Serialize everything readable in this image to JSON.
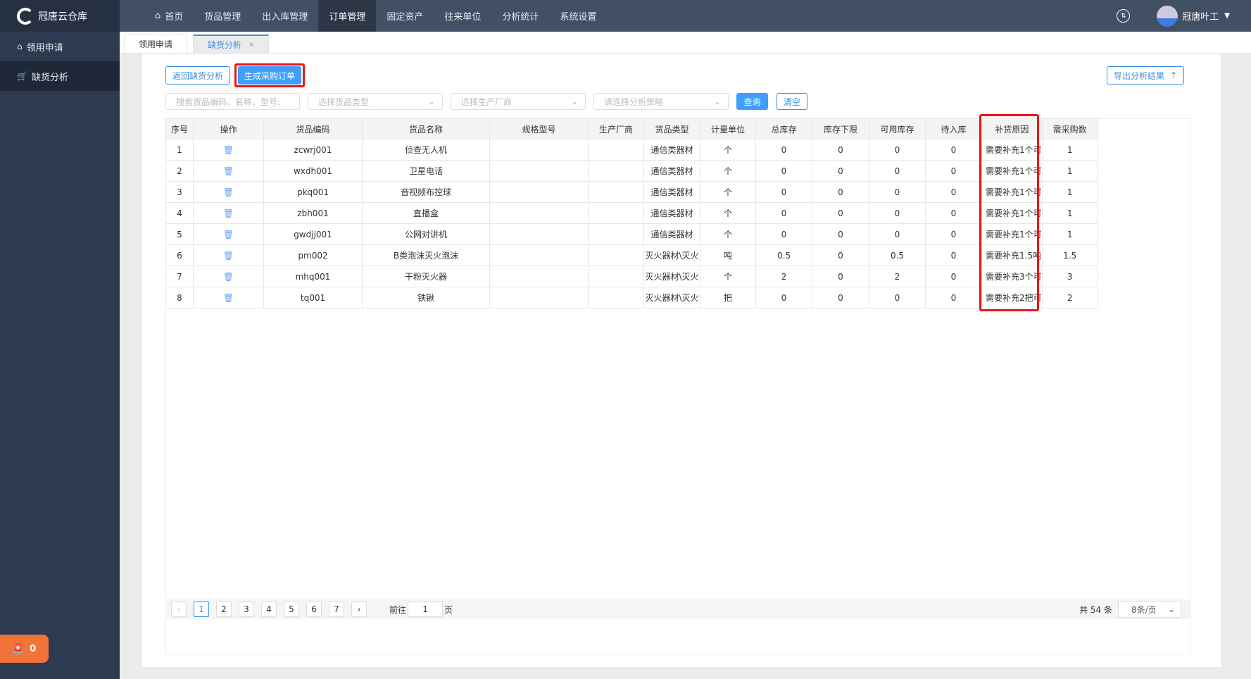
{
  "app": {
    "title": "冠唐云仓库"
  },
  "sidebar": {
    "items": [
      {
        "label": "领用申请",
        "icon": "box-icon"
      },
      {
        "label": "缺货分析",
        "icon": "cart-icon"
      }
    ]
  },
  "topnav": {
    "items": [
      "首页",
      "货品管理",
      "出入库管理",
      "订单管理",
      "固定资产",
      "往来单位",
      "分析统计",
      "系统设置"
    ],
    "active": "订单管理",
    "user": "冠唐叶工"
  },
  "tabs": [
    {
      "label": "领用申请"
    },
    {
      "label": "缺货分析",
      "close": "×"
    }
  ],
  "toolbar": {
    "back": "返回缺货分析",
    "generate": "生成采购订单",
    "export": "导出分析结果",
    "export_icon": "⇡"
  },
  "filters": {
    "search_placeholder": "搜索货品编码、名称、型号:",
    "type_placeholder": "选择货品类型",
    "maker_placeholder": "选择生产厂商",
    "strategy_placeholder": "请选择分析策略",
    "query": "查询",
    "clear": "清空"
  },
  "table": {
    "headers": [
      "序号",
      "操作",
      "货品编码",
      "货品名称",
      "规格型号",
      "生产厂商",
      "货品类型",
      "计量单位",
      "总库存",
      "库存下限",
      "可用库存",
      "待入库",
      "补货原因",
      "需采购数"
    ],
    "rows": [
      [
        "1",
        "",
        "zcwrj001",
        "侦查无人机",
        "",
        "",
        "通信类器材",
        "个",
        "0",
        "0",
        "0",
        "0",
        "需要补充1个可",
        "1"
      ],
      [
        "2",
        "",
        "wxdh001",
        "卫星电话",
        "",
        "",
        "通信类器材",
        "个",
        "0",
        "0",
        "0",
        "0",
        "需要补充1个可",
        "1"
      ],
      [
        "3",
        "",
        "pkq001",
        "音视频布控球",
        "",
        "",
        "通信类器材",
        "个",
        "0",
        "0",
        "0",
        "0",
        "需要补充1个可",
        "1"
      ],
      [
        "4",
        "",
        "zbh001",
        "直播盒",
        "",
        "",
        "通信类器材",
        "个",
        "0",
        "0",
        "0",
        "0",
        "需要补充1个可",
        "1"
      ],
      [
        "5",
        "",
        "gwdjj001",
        "公网对讲机",
        "",
        "",
        "通信类器材",
        "个",
        "0",
        "0",
        "0",
        "0",
        "需要补充1个可",
        "1"
      ],
      [
        "6",
        "",
        "pm002",
        "B类泡沫灭火泡沫",
        "",
        "",
        "灭火器材\\灭火",
        "吨",
        "0.5",
        "0",
        "0.5",
        "0",
        "需要补充1.5吨",
        "1.5"
      ],
      [
        "7",
        "",
        "mhq001",
        "干粉灭火器",
        "",
        "",
        "灭火器材\\灭火",
        "个",
        "2",
        "0",
        "2",
        "0",
        "需要补充3个可",
        "3"
      ],
      [
        "8",
        "",
        "tq001",
        "铁锹",
        "",
        "",
        "灭火器材\\灭火",
        "把",
        "0",
        "0",
        "0",
        "0",
        "需要补充2把可",
        "2"
      ]
    ]
  },
  "pager": {
    "pages": [
      "1",
      "2",
      "3",
      "4",
      "5",
      "6",
      "7"
    ],
    "current": "1",
    "goto_label": "前往",
    "goto_value": "1",
    "page_unit": "页",
    "total": "共 54 条",
    "size": "8条/页"
  },
  "alarm": {
    "count": "0"
  }
}
